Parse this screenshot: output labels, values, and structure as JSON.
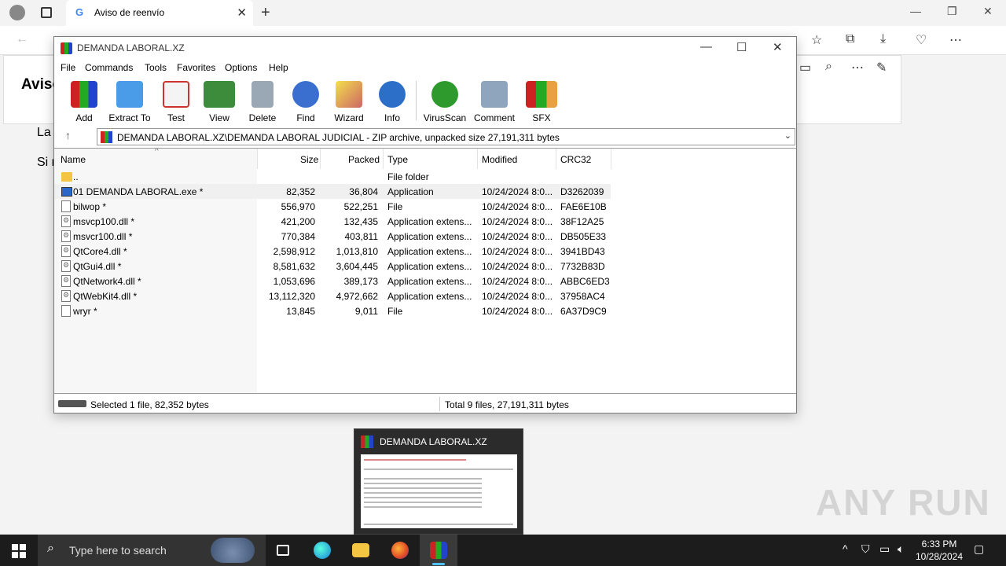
{
  "browser": {
    "tab_title": "Aviso de reenvío",
    "page_title": "Aviso",
    "page_text1": "La",
    "page_text2": "Si n"
  },
  "winrar": {
    "title": "DEMANDA LABORAL.XZ",
    "menu": [
      "File",
      "Commands",
      "Tools",
      "Favorites",
      "Options",
      "Help"
    ],
    "tools": [
      "Add",
      "Extract To",
      "Test",
      "View",
      "Delete",
      "Find",
      "Wizard",
      "Info",
      "VirusScan",
      "Comment",
      "SFX"
    ],
    "path": "DEMANDA LABORAL.XZ\\DEMANDA LABORAL JUDICIAL - ZIP archive, unpacked size 27,191,311 bytes",
    "columns": [
      "Name",
      "Size",
      "Packed",
      "Type",
      "Modified",
      "CRC32"
    ],
    "rows": [
      {
        "name": "..",
        "size": "",
        "packed": "",
        "type": "File folder",
        "modified": "",
        "crc": "",
        "icon": "folder"
      },
      {
        "name": "01 DEMANDA LABORAL.exe *",
        "size": "82,352",
        "packed": "36,804",
        "type": "Application",
        "modified": "10/24/2024 8:0...",
        "crc": "D3262039",
        "icon": "exe"
      },
      {
        "name": "bilwop *",
        "size": "556,970",
        "packed": "522,251",
        "type": "File",
        "modified": "10/24/2024 8:0...",
        "crc": "FAE6E10B",
        "icon": "file"
      },
      {
        "name": "msvcp100.dll *",
        "size": "421,200",
        "packed": "132,435",
        "type": "Application extens...",
        "modified": "10/24/2024 8:0...",
        "crc": "38F12A25",
        "icon": "dll"
      },
      {
        "name": "msvcr100.dll *",
        "size": "770,384",
        "packed": "403,811",
        "type": "Application extens...",
        "modified": "10/24/2024 8:0...",
        "crc": "DB505E33",
        "icon": "dll"
      },
      {
        "name": "QtCore4.dll *",
        "size": "2,598,912",
        "packed": "1,013,810",
        "type": "Application extens...",
        "modified": "10/24/2024 8:0...",
        "crc": "3941BD43",
        "icon": "dll"
      },
      {
        "name": "QtGui4.dll *",
        "size": "8,581,632",
        "packed": "3,604,445",
        "type": "Application extens...",
        "modified": "10/24/2024 8:0...",
        "crc": "7732B83D",
        "icon": "dll"
      },
      {
        "name": "QtNetwork4.dll *",
        "size": "1,053,696",
        "packed": "389,173",
        "type": "Application extens...",
        "modified": "10/24/2024 8:0...",
        "crc": "ABBC6ED3",
        "icon": "dll"
      },
      {
        "name": "QtWebKit4.dll *",
        "size": "13,112,320",
        "packed": "4,972,662",
        "type": "Application extens...",
        "modified": "10/24/2024 8:0...",
        "crc": "37958AC4",
        "icon": "dll"
      },
      {
        "name": "wryr *",
        "size": "13,845",
        "packed": "9,011",
        "type": "File",
        "modified": "10/24/2024 8:0...",
        "crc": "6A37D9C9",
        "icon": "file"
      }
    ],
    "status_left": "Selected 1 file, 82,352 bytes",
    "status_right": "Total 9 files, 27,191,311 bytes"
  },
  "thumbnail": {
    "title": "DEMANDA LABORAL.XZ"
  },
  "watermark": "ANY RUN",
  "taskbar": {
    "search_placeholder": "Type here to search",
    "time": "6:33 PM",
    "date": "10/28/2024"
  }
}
